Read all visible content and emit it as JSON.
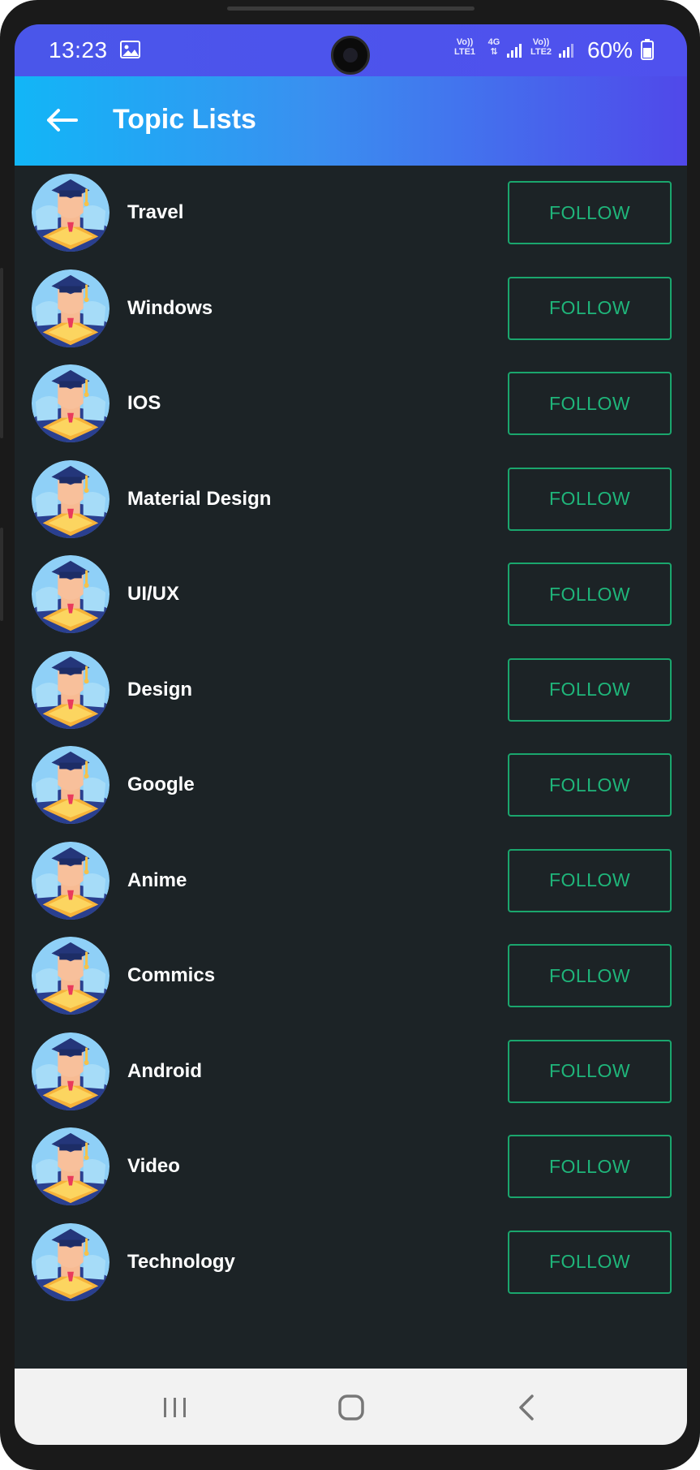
{
  "statusbar": {
    "time": "13:23",
    "sim1_text": "Vo))",
    "sim1_sub": "LTE1",
    "net_type": "4G",
    "sim2_text": "Vo))",
    "sim2_sub": "LTE2",
    "battery": "60%",
    "icons": [
      "gallery-icon",
      "signal-icon",
      "battery-icon"
    ]
  },
  "appbar": {
    "title": "Topic Lists",
    "back_icon": "arrow-left-icon"
  },
  "topics": [
    {
      "name": "Travel",
      "action": "FOLLOW"
    },
    {
      "name": "Windows",
      "action": "FOLLOW"
    },
    {
      "name": "IOS",
      "action": "FOLLOW"
    },
    {
      "name": "Material Design",
      "action": "FOLLOW"
    },
    {
      "name": "UI/UX",
      "action": "FOLLOW"
    },
    {
      "name": "Design",
      "action": "FOLLOW"
    },
    {
      "name": "Google",
      "action": "FOLLOW"
    },
    {
      "name": "Anime",
      "action": "FOLLOW"
    },
    {
      "name": "Commics",
      "action": "FOLLOW"
    },
    {
      "name": "Android",
      "action": "FOLLOW"
    },
    {
      "name": "Video",
      "action": "FOLLOW"
    },
    {
      "name": "Technology",
      "action": "FOLLOW"
    }
  ],
  "navbar": {
    "icons": [
      "recent-apps-icon",
      "home-icon",
      "back-icon"
    ]
  },
  "colors": {
    "background": "#1c2326",
    "accent_green": "#1fb57a",
    "appbar_start": "#12b6f7",
    "appbar_end": "#5048ea"
  }
}
